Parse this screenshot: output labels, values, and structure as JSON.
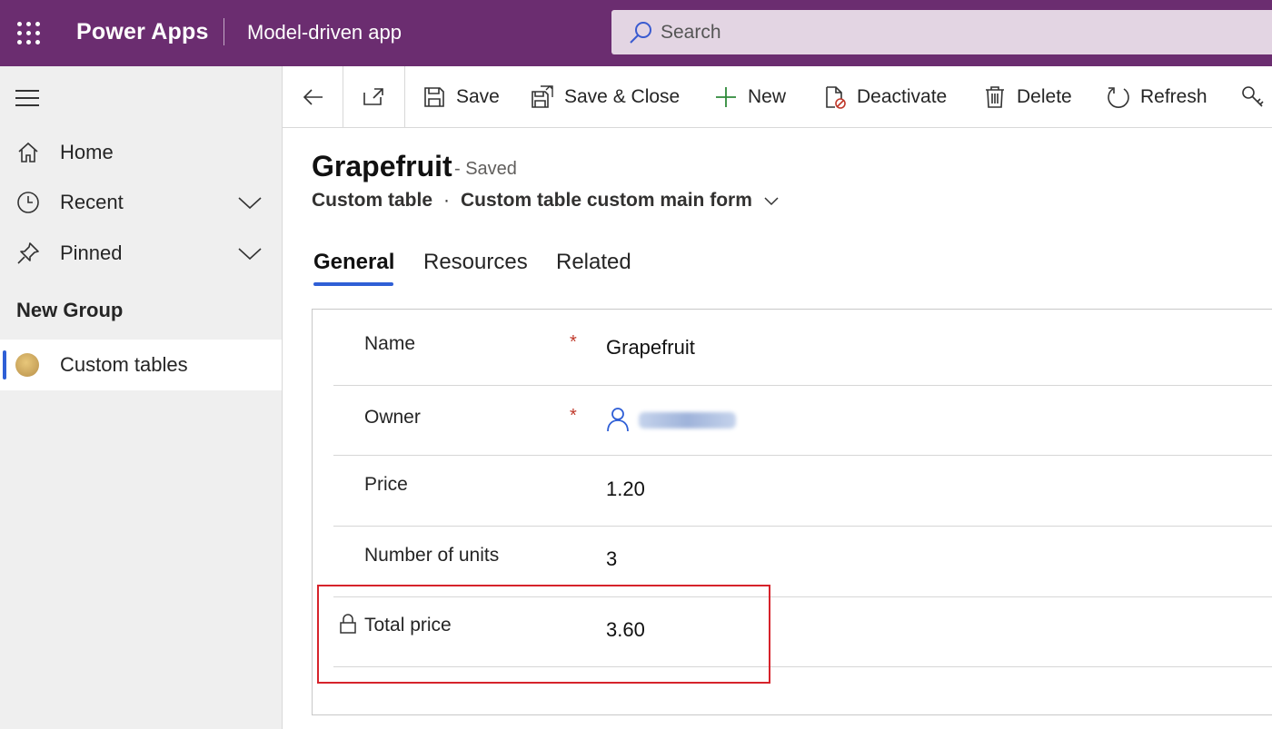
{
  "header": {
    "app_name": "Power Apps",
    "app_subtitle": "Model-driven app",
    "search_placeholder": "Search",
    "brand_color": "#6b2d70"
  },
  "sidebar": {
    "items": [
      {
        "label": "Home",
        "icon": "home-icon"
      },
      {
        "label": "Recent",
        "icon": "clock-icon",
        "expandable": true
      },
      {
        "label": "Pinned",
        "icon": "pin-icon",
        "expandable": true
      }
    ],
    "group_label": "New Group",
    "group_items": [
      {
        "label": "Custom tables",
        "icon": "entity-emoji-icon",
        "active": true
      }
    ],
    "accent_color": "#2f5fd6"
  },
  "commandbar": {
    "save": "Save",
    "save_close": "Save & Close",
    "new": "New",
    "deactivate": "Deactivate",
    "delete": "Delete",
    "refresh": "Refresh"
  },
  "record": {
    "title": "Grapefruit",
    "status": "- Saved",
    "entity": "Custom table",
    "separator": "·",
    "form_name": "Custom table custom main form"
  },
  "tabs": [
    {
      "label": "General",
      "active": true
    },
    {
      "label": "Resources",
      "active": false
    },
    {
      "label": "Related",
      "active": false
    }
  ],
  "fields": [
    {
      "label": "Name",
      "required": true,
      "required_mark": "*",
      "value": "Grapefruit"
    },
    {
      "label": "Owner",
      "required": true,
      "required_mark": "*",
      "value": ""
    },
    {
      "label": "Price",
      "required": false,
      "value": "1.20"
    },
    {
      "label": "Number of units",
      "required": false,
      "value": "3"
    },
    {
      "label": "Total price",
      "required": false,
      "locked": true,
      "value": "3.60"
    }
  ],
  "highlight_color": "#d6232b"
}
